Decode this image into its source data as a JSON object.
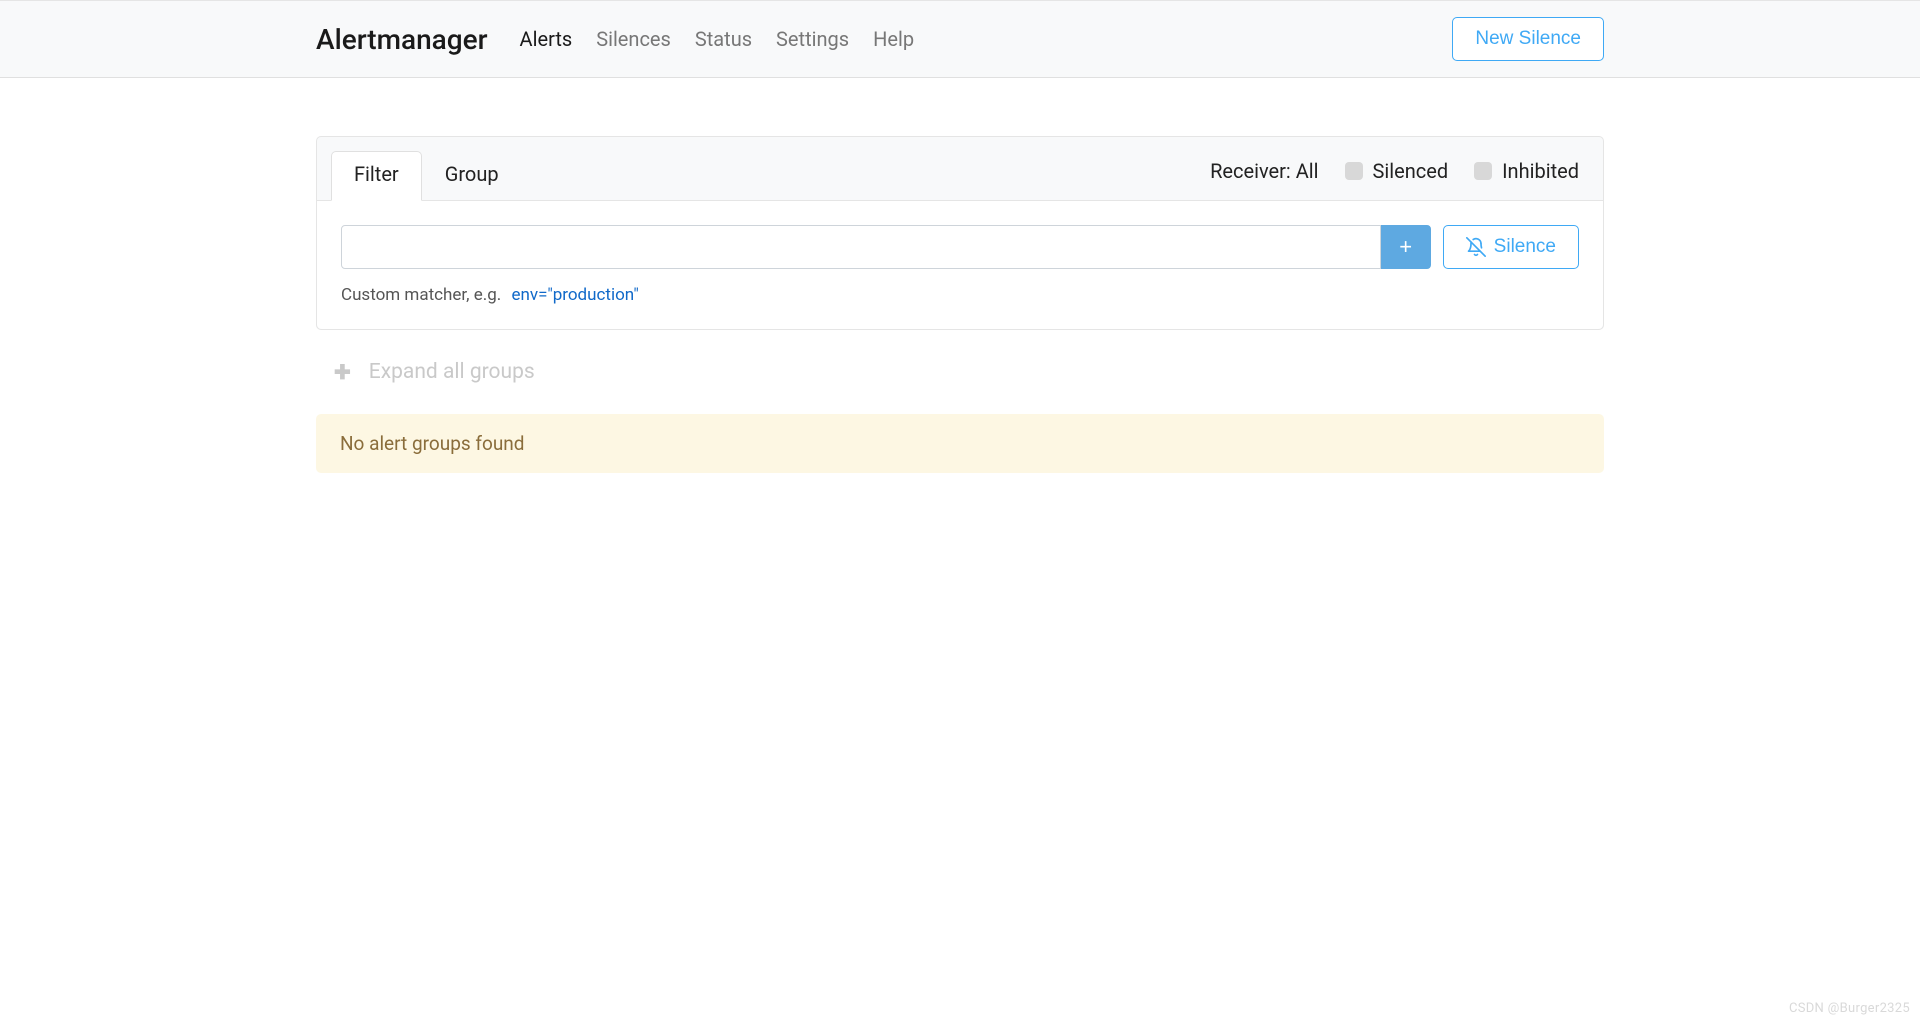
{
  "navbar": {
    "brand": "Alertmanager",
    "links": {
      "alerts": "Alerts",
      "silences": "Silences",
      "status": "Status",
      "settings": "Settings",
      "help": "Help"
    },
    "new_silence_label": "New Silence"
  },
  "card": {
    "tabs": {
      "filter": "Filter",
      "group": "Group"
    },
    "receiver_label": "Receiver: All",
    "silenced_label": "Silenced",
    "inhibited_label": "Inhibited",
    "filter_placeholder": "",
    "add_button_label": "+",
    "silence_button_label": "Silence",
    "hint_prefix": "Custom matcher, e.g.",
    "hint_example": "env=\"production\""
  },
  "expand_all_label": "Expand all groups",
  "no_groups_message": "No alert groups found",
  "watermark": "CSDN @Burger2325"
}
